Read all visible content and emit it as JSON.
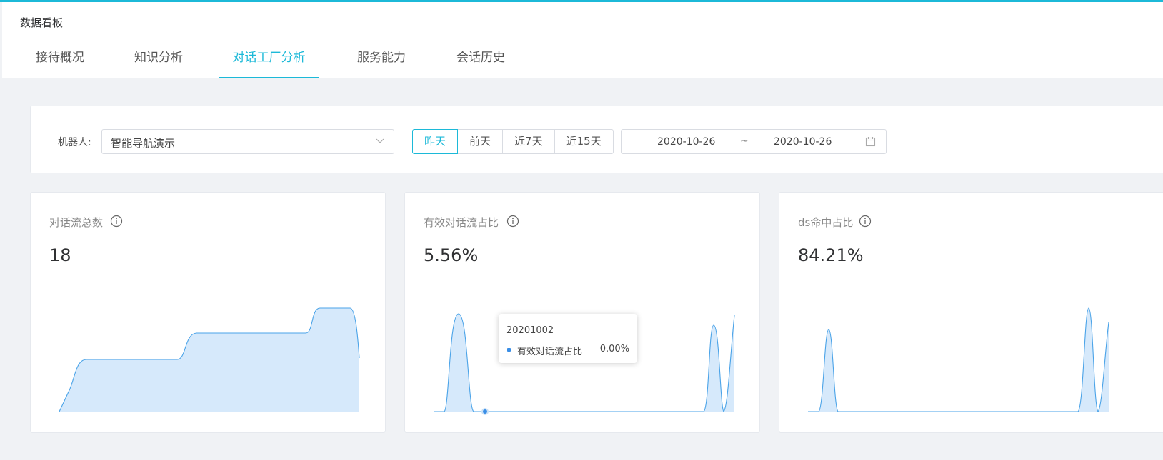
{
  "header": {
    "title": "数据看板",
    "tabs": [
      {
        "label": "接待概况"
      },
      {
        "label": "知识分析"
      },
      {
        "label": "对话工厂分析"
      },
      {
        "label": "服务能力"
      },
      {
        "label": "会话历史"
      }
    ],
    "active_tab": "对话工厂分析"
  },
  "filter": {
    "robot_label": "机器人:",
    "robot_value": "智能导航演示",
    "quick_buttons": [
      {
        "label": "昨天"
      },
      {
        "label": "前天"
      },
      {
        "label": "近7天"
      },
      {
        "label": "近15天"
      }
    ],
    "active_quick": "昨天",
    "date_start": "2020-10-26",
    "date_separator": "~",
    "date_end": "2020-10-26"
  },
  "cards": [
    {
      "title": "对话流总数",
      "value": "18"
    },
    {
      "title": "有效对话流占比",
      "value": "5.56%"
    },
    {
      "title": "ds命中占比",
      "value": "84.21%"
    }
  ],
  "tooltip": {
    "date": "20201002",
    "series_name": "有效对话流占比",
    "series_value": "0.00%"
  },
  "colors": {
    "accent": "#1cb9d8",
    "line": "#4aa3e8",
    "area": "#d6e9fb"
  },
  "icons": {
    "select_arrow": "chevron-down-icon",
    "calendar": "calendar-icon",
    "info": "info-circle-icon"
  }
}
